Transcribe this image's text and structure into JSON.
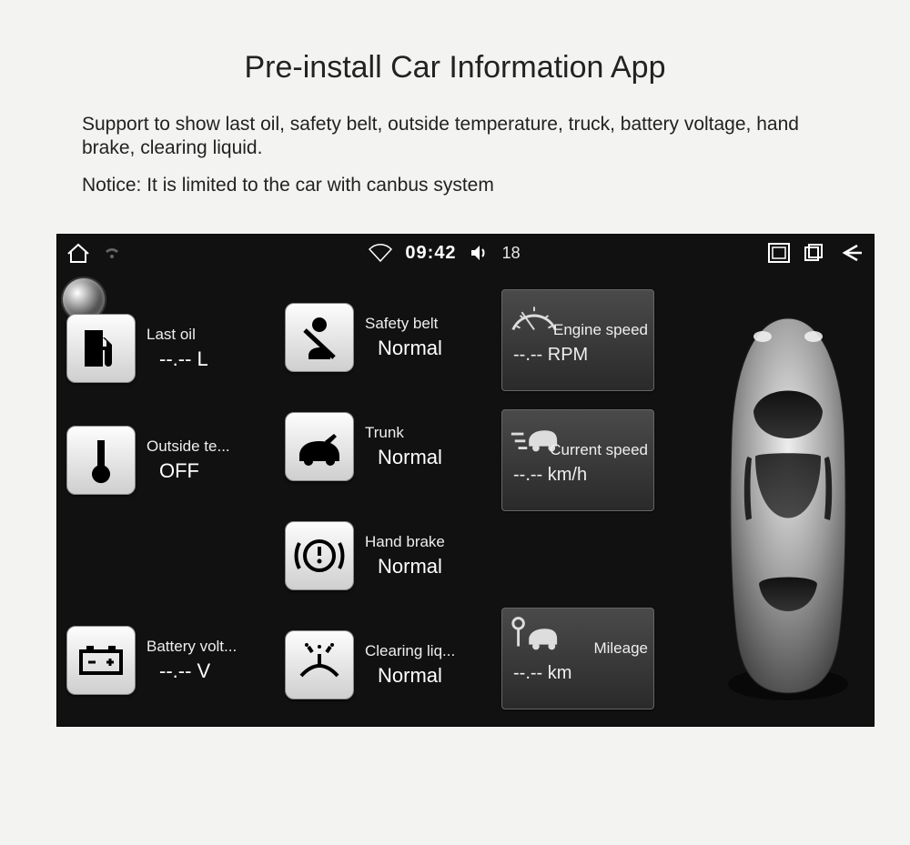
{
  "header": {
    "title": "Pre-install Car Information App",
    "desc1": "Support to show last oil, safety belt, outside temperature, truck, battery voltage, hand brake, clearing liquid.",
    "desc2": "Notice: It is limited to the car with canbus system"
  },
  "statusbar": {
    "clock": "09:42",
    "volume": "18"
  },
  "left": [
    {
      "label": "Last oil",
      "value": "--.-- L",
      "icon": "fuel-icon"
    },
    {
      "label": "Outside te...",
      "value": "OFF",
      "icon": "thermometer-icon"
    },
    {
      "label": "Battery volt...",
      "value": "--.-- V",
      "icon": "battery-icon"
    }
  ],
  "mid": [
    {
      "label": "Safety belt",
      "value": "Normal",
      "icon": "seatbelt-icon"
    },
    {
      "label": "Trunk",
      "value": "Normal",
      "icon": "trunk-icon"
    },
    {
      "label": "Hand brake",
      "value": "Normal",
      "icon": "handbrake-icon"
    },
    {
      "label": "Clearing liq...",
      "value": "Normal",
      "icon": "washer-icon"
    }
  ],
  "cards": [
    {
      "label": "Engine speed",
      "value": "--.-- RPM",
      "icon": "gauge-icon"
    },
    {
      "label": "Current speed",
      "value": "--.-- km/h",
      "icon": "speed-icon"
    },
    {
      "label": "Mileage",
      "value": "--.-- km",
      "icon": "mileage-icon"
    }
  ]
}
